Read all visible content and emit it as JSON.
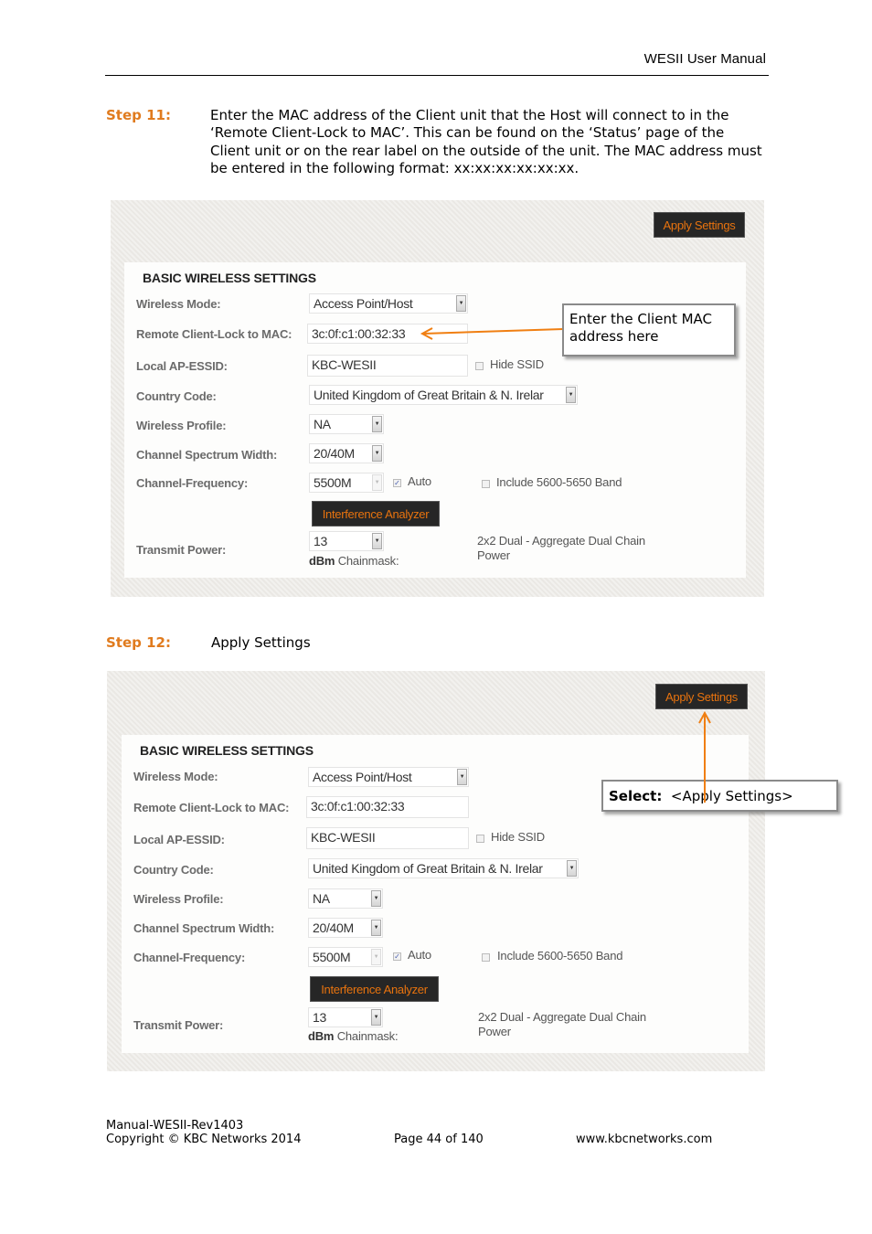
{
  "header": {
    "title": "WESII User Manual"
  },
  "steps": [
    {
      "label": "Step 11:",
      "text": "Enter the MAC address of the Client unit that the Host will connect to in the ‘Remote Client-Lock to MAC’. This can be found on the ‘Status’ page of the Client unit or on the rear label on the outside of the unit. The MAC address must be entered in the following format: xx:xx:xx:xx:xx:xx."
    },
    {
      "label": "Step 12:",
      "text": "Apply Settings"
    }
  ],
  "screenshots": [
    {
      "apply_button": "Apply Settings",
      "section_title": "BASIC WIRELESS SETTINGS",
      "fields": {
        "wireless_mode": {
          "label": "Wireless Mode:",
          "value": "Access Point/Host"
        },
        "remote_mac": {
          "label": "Remote Client-Lock to MAC:",
          "value": "3c:0f:c1:00:32:33"
        },
        "essid": {
          "label": "Local AP-ESSID:",
          "value": "KBC-WESII",
          "hide_ssid_label": "Hide SSID",
          "hide_ssid_checked": false
        },
        "country": {
          "label": "Country Code:",
          "value": "United Kingdom of Great Britain & N. Irelar"
        },
        "profile": {
          "label": "Wireless Profile:",
          "value": "NA"
        },
        "width": {
          "label": "Channel Spectrum Width:",
          "value": "20/40M"
        },
        "frequency": {
          "label": "Channel-Frequency:",
          "value": "5500M",
          "auto_label": "Auto",
          "auto_checked": true,
          "band_label": "Include 5600-5650 Band",
          "band_checked": false
        },
        "interference_button": "Interference Analyzer",
        "power": {
          "label": "Transmit Power:",
          "value": "13",
          "unit": "dBm",
          "chainmask_label": "Chainmask:",
          "chainmask_value_line1": "2x2 Dual - Aggregate Dual Chain",
          "chainmask_value_line2": "Power"
        }
      },
      "callout": {
        "text_line1": "Enter the Client MAC",
        "text_line2": "address here"
      }
    },
    {
      "apply_button": "Apply Settings",
      "section_title": "BASIC WIRELESS SETTINGS",
      "fields": {
        "wireless_mode": {
          "label": "Wireless Mode:",
          "value": "Access Point/Host"
        },
        "remote_mac": {
          "label": "Remote Client-Lock to MAC:",
          "value": "3c:0f:c1:00:32:33"
        },
        "essid": {
          "label": "Local AP-ESSID:",
          "value": "KBC-WESII",
          "hide_ssid_label": "Hide SSID",
          "hide_ssid_checked": false
        },
        "country": {
          "label": "Country Code:",
          "value": "United Kingdom of Great Britain & N. Irelar"
        },
        "profile": {
          "label": "Wireless Profile:",
          "value": "NA"
        },
        "width": {
          "label": "Channel Spectrum Width:",
          "value": "20/40M"
        },
        "frequency": {
          "label": "Channel-Frequency:",
          "value": "5500M",
          "auto_label": "Auto",
          "auto_checked": true,
          "band_label": "Include 5600-5650 Band",
          "band_checked": false
        },
        "interference_button": "Interference Analyzer",
        "power": {
          "label": "Transmit Power:",
          "value": "13",
          "unit": "dBm",
          "chainmask_label": "Chainmask:",
          "chainmask_value_line1": "2x2 Dual - Aggregate Dual Chain",
          "chainmask_value_line2": "Power"
        }
      },
      "callout": {
        "bold": "Select:",
        "text": "<Apply Settings>"
      }
    }
  ],
  "colors": {
    "accent": "#e07b1e",
    "arrow": "#f07f12",
    "button_bg": "#262626"
  },
  "footer": {
    "doc_id": "Manual-WESII-Rev1403",
    "copyright": "Copyright © KBC Networks 2014",
    "page": "Page 44 of 140",
    "website": "www.kbcnetworks.com"
  }
}
